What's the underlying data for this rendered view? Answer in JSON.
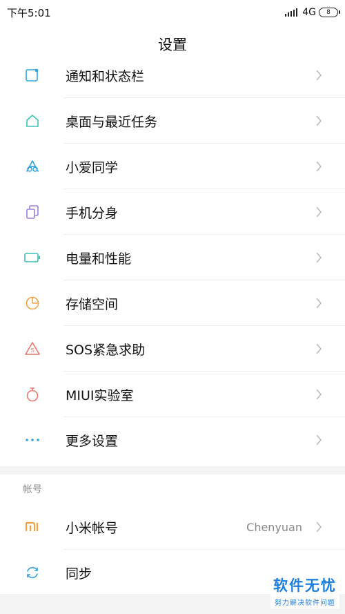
{
  "status": {
    "time": "下午5:01",
    "network": "4G",
    "battery": "8"
  },
  "header": {
    "title": "设置"
  },
  "settings": {
    "items": [
      {
        "label": "通知和状态栏",
        "icon": "notification-icon"
      },
      {
        "label": "桌面与最近任务",
        "icon": "home-icon"
      },
      {
        "label": "小爱同学",
        "icon": "xiaoai-icon"
      },
      {
        "label": "手机分身",
        "icon": "second-space-icon"
      },
      {
        "label": "电量和性能",
        "icon": "battery-icon"
      },
      {
        "label": "存储空间",
        "icon": "storage-pie-icon"
      },
      {
        "label": "SOS紧急求助",
        "icon": "sos-icon"
      },
      {
        "label": "MIUI实验室",
        "icon": "lab-flask-icon"
      },
      {
        "label": "更多设置",
        "icon": "more-dots-icon"
      }
    ]
  },
  "account_section": {
    "header": "帐号",
    "items": [
      {
        "label": "小米帐号",
        "value": "Chenyuan",
        "icon": "mi-logo-icon"
      },
      {
        "label": "同步",
        "icon": "sync-icon"
      }
    ]
  },
  "watermark": {
    "main": "软件无忧",
    "sub": "努力解决软件问题"
  },
  "colors": {
    "accent": "#1d7fe0",
    "icon_blue": "#2fa3e0",
    "icon_teal": "#3cc0b4",
    "icon_purple": "#9b7fe0",
    "icon_orange": "#f0a040",
    "icon_pink": "#e8786e"
  }
}
